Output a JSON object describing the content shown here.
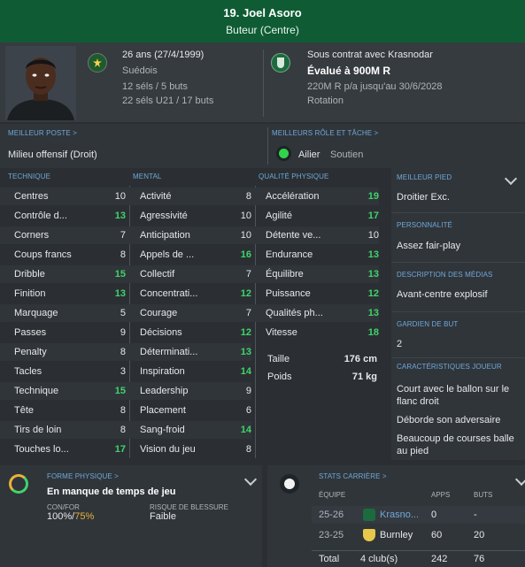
{
  "header": {
    "name": "19. Joel Asoro",
    "position": "Buteur (Centre)"
  },
  "info": {
    "age": "26 ans (27/4/1999)",
    "nationality": "Suédois",
    "caps": "12 séls / 5 buts",
    "u21": "22 séls U21 / 17 buts",
    "contract_label": "Sous contrat avec Krasnodar",
    "value": "Évalué à 900M R",
    "salary": "220M R p/a jusqu'au 30/6/2028",
    "status": "Rotation"
  },
  "roles": {
    "best_pos_title": "MEILLEUR POSTE >",
    "best_pos": "Milieu offensif (Droit)",
    "best_role_title": "MEILLEURS RÔLE ET TÂCHE >",
    "best_role": "Ailier",
    "best_duty": "Soutien"
  },
  "attributes": {
    "technique_title": "TECHNIQUE",
    "mental_title": "MENTAL",
    "physique_title": "QUALITÉ PHYSIQUE",
    "technique": [
      {
        "name": "Centres",
        "value": "10"
      },
      {
        "name": "Contrôle d...",
        "value": "13"
      },
      {
        "name": "Corners",
        "value": "7"
      },
      {
        "name": "Coups francs",
        "value": "8"
      },
      {
        "name": "Dribble",
        "value": "15"
      },
      {
        "name": "Finition",
        "value": "13"
      },
      {
        "name": "Marquage",
        "value": "5"
      },
      {
        "name": "Passes",
        "value": "9"
      },
      {
        "name": "Penalty",
        "value": "8"
      },
      {
        "name": "Tacles",
        "value": "3"
      },
      {
        "name": "Technique",
        "value": "15"
      },
      {
        "name": "Tête",
        "value": "8"
      },
      {
        "name": "Tirs de loin",
        "value": "8"
      },
      {
        "name": "Touches lo...",
        "value": "17"
      }
    ],
    "mental": [
      {
        "name": "Activité",
        "value": "8"
      },
      {
        "name": "Agressivité",
        "value": "10"
      },
      {
        "name": "Anticipation",
        "value": "10"
      },
      {
        "name": "Appels de ...",
        "value": "16"
      },
      {
        "name": "Collectif",
        "value": "7"
      },
      {
        "name": "Concentrati...",
        "value": "12"
      },
      {
        "name": "Courage",
        "value": "7"
      },
      {
        "name": "Décisions",
        "value": "12"
      },
      {
        "name": "Déterminati...",
        "value": "13"
      },
      {
        "name": "Inspiration",
        "value": "14"
      },
      {
        "name": "Leadership",
        "value": "9"
      },
      {
        "name": "Placement",
        "value": "6"
      },
      {
        "name": "Sang-froid",
        "value": "14"
      },
      {
        "name": "Vision du jeu",
        "value": "8"
      }
    ],
    "physique": [
      {
        "name": "Accélération",
        "value": "19"
      },
      {
        "name": "Agilité",
        "value": "17"
      },
      {
        "name": "Détente ve...",
        "value": "10"
      },
      {
        "name": "Endurance",
        "value": "13"
      },
      {
        "name": "Équilibre",
        "value": "13"
      },
      {
        "name": "Puissance",
        "value": "12"
      },
      {
        "name": "Qualités ph...",
        "value": "13"
      },
      {
        "name": "Vitesse",
        "value": "18"
      }
    ],
    "height_label": "Taille",
    "height": "176 cm",
    "weight_label": "Poids",
    "weight": "71 kg"
  },
  "side": {
    "foot_title": "MEILLEUR PIED",
    "foot": "Droitier Exc.",
    "personality_title": "PERSONNALITÉ",
    "personality": "Assez fair-play",
    "media_title": "DESCRIPTION DES MÉDIAS",
    "media": "Avant-centre explosif",
    "gk_title": "GARDIEN DE BUT",
    "gk": "2",
    "traits_title": "CARACTÉRISTIQUES JOUEUR",
    "traits": [
      "Court avec le ballon sur le flanc droit",
      "Déborde son adversaire",
      "Beaucoup de courses balle au pied"
    ]
  },
  "form": {
    "title": "FORME PHYSIQUE >",
    "status": "En manque de temps de jeu",
    "confor_label": "CON/FOR",
    "confor_a": "100%",
    "confor_sep": "/",
    "confor_b": "75%",
    "injury_label": "RISQUE DE BLESSURE",
    "injury": "Faible"
  },
  "career": {
    "title": "STATS CARRIÈRE >",
    "col_team": "ÉQUIPE",
    "col_apps": "APPS",
    "col_goals": "BUTS",
    "rows": [
      {
        "season": "25-26",
        "club": "Krasno...",
        "apps": "0",
        "goals": "-"
      },
      {
        "season": "23-25",
        "club": "Burnley",
        "apps": "60",
        "goals": "20"
      }
    ],
    "total_label": "Total",
    "total_clubs": "4 club(s)",
    "total_apps": "242",
    "total_goals": "76"
  },
  "colors": {
    "header": "#0f5c34",
    "accent_title": "#6fa8d8",
    "high_value": "#3fd46b",
    "confor_b": "#e8b23a"
  }
}
